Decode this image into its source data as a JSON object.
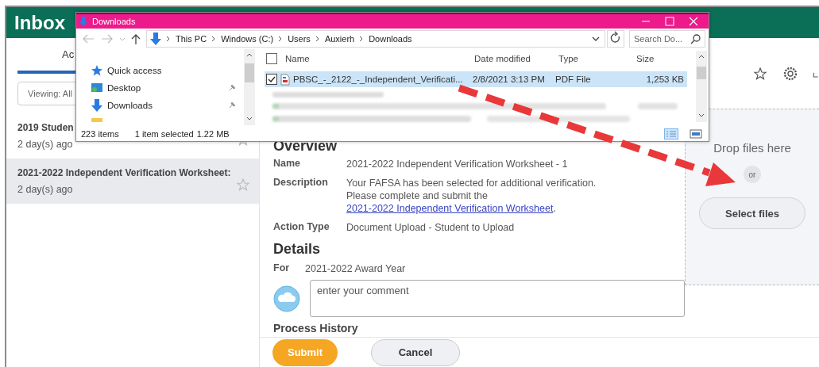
{
  "inbox": {
    "title": "Inbox",
    "tabs": [
      {
        "label": "Ac",
        "selected": true
      }
    ],
    "filter": {
      "value": "Viewing: All"
    },
    "items": [
      {
        "title": "2019 Studen",
        "age": "2 day(s) ago",
        "selected": false
      },
      {
        "title": "2021-2022 Independent Verification Worksheet:",
        "age": "2 day(s) ago",
        "selected": true
      }
    ]
  },
  "task": {
    "overview": {
      "heading": "Overview",
      "fields": [
        {
          "label": "Name",
          "text": "2021-2022 Independent Verification Worksheet - 1"
        },
        {
          "label": "Description",
          "text": "Your FAFSA has been selected for additional verification.",
          "text_2": "Please complete and submit the",
          "link": "2021-2022 Independent Verification Worksheet",
          "text_3": "."
        },
        {
          "label": "Action Type",
          "text": "Document Upload - Student to Upload"
        }
      ]
    },
    "details": {
      "heading": "Details",
      "for_label": "For",
      "for_value": "2021-2022 Award Year"
    },
    "comment": {
      "placeholder": "enter your comment"
    },
    "process_history": "Process History",
    "buttons": [
      {
        "label": "Submit",
        "kind": "primary"
      },
      {
        "label": "Cancel",
        "kind": "secondary"
      }
    ]
  },
  "dropzone": {
    "prompt": "Drop files here",
    "or": "or",
    "button": "Select files"
  },
  "explorer": {
    "title": "Downloads",
    "breadcrumb": [
      "This PC",
      "Windows (C:)",
      "Users",
      "Auxierh",
      "Downloads"
    ],
    "search": {
      "placeholder": "Search Do..."
    },
    "nav": [
      {
        "label": "Quick access",
        "kind": "star",
        "pinned": false
      },
      {
        "label": "Desktop",
        "kind": "desktop",
        "pinned": true
      },
      {
        "label": "Downloads",
        "kind": "download",
        "pinned": true
      }
    ],
    "all_checked": false,
    "columns": [
      "Name",
      "Date modified",
      "Type",
      "Size"
    ],
    "files": [
      {
        "name": "PBSC_-_2122_-_Independent_Verificati...",
        "date": "2/8/2021 3:13 PM",
        "type": "PDF File",
        "size": "1,253 KB",
        "selected": true,
        "checked": true
      }
    ],
    "status": {
      "count": "223 items",
      "selection": "1 item selected",
      "size": "1.22 MB"
    }
  }
}
